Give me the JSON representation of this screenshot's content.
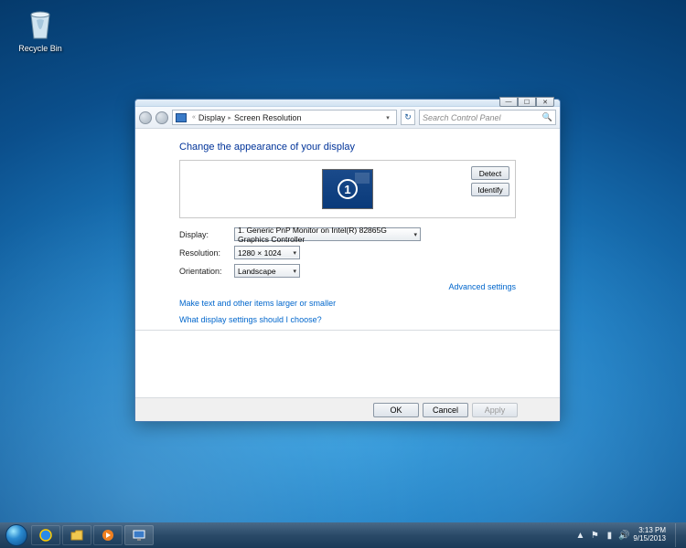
{
  "desktop": {
    "recycle_bin": "Recycle Bin"
  },
  "window": {
    "back": "◄",
    "fwd": "►",
    "breadcrumb": {
      "root_icon": "display-icon",
      "part1": "Display",
      "part2": "Screen Resolution"
    },
    "refresh": "↻",
    "search_placeholder": "Search Control Panel",
    "min": "—",
    "max": "☐",
    "close": "✕"
  },
  "page": {
    "heading": "Change the appearance of your display",
    "detect": "Detect",
    "identify": "Identify",
    "monitor_number": "1",
    "labels": {
      "display": "Display:",
      "resolution": "Resolution:",
      "orientation": "Orientation:"
    },
    "values": {
      "display": "1. Generic PnP Monitor on Intel(R) 82865G Graphics Controller",
      "resolution": "1280 × 1024",
      "orientation": "Landscape"
    },
    "advanced": "Advanced settings",
    "link1": "Make text and other items larger or smaller",
    "link2": "What display settings should I choose?"
  },
  "footer": {
    "ok": "OK",
    "cancel": "Cancel",
    "apply": "Apply"
  },
  "taskbar": {
    "tray_up": "▲",
    "clock": {
      "time": "3:13 PM",
      "date": "9/15/2013"
    }
  }
}
